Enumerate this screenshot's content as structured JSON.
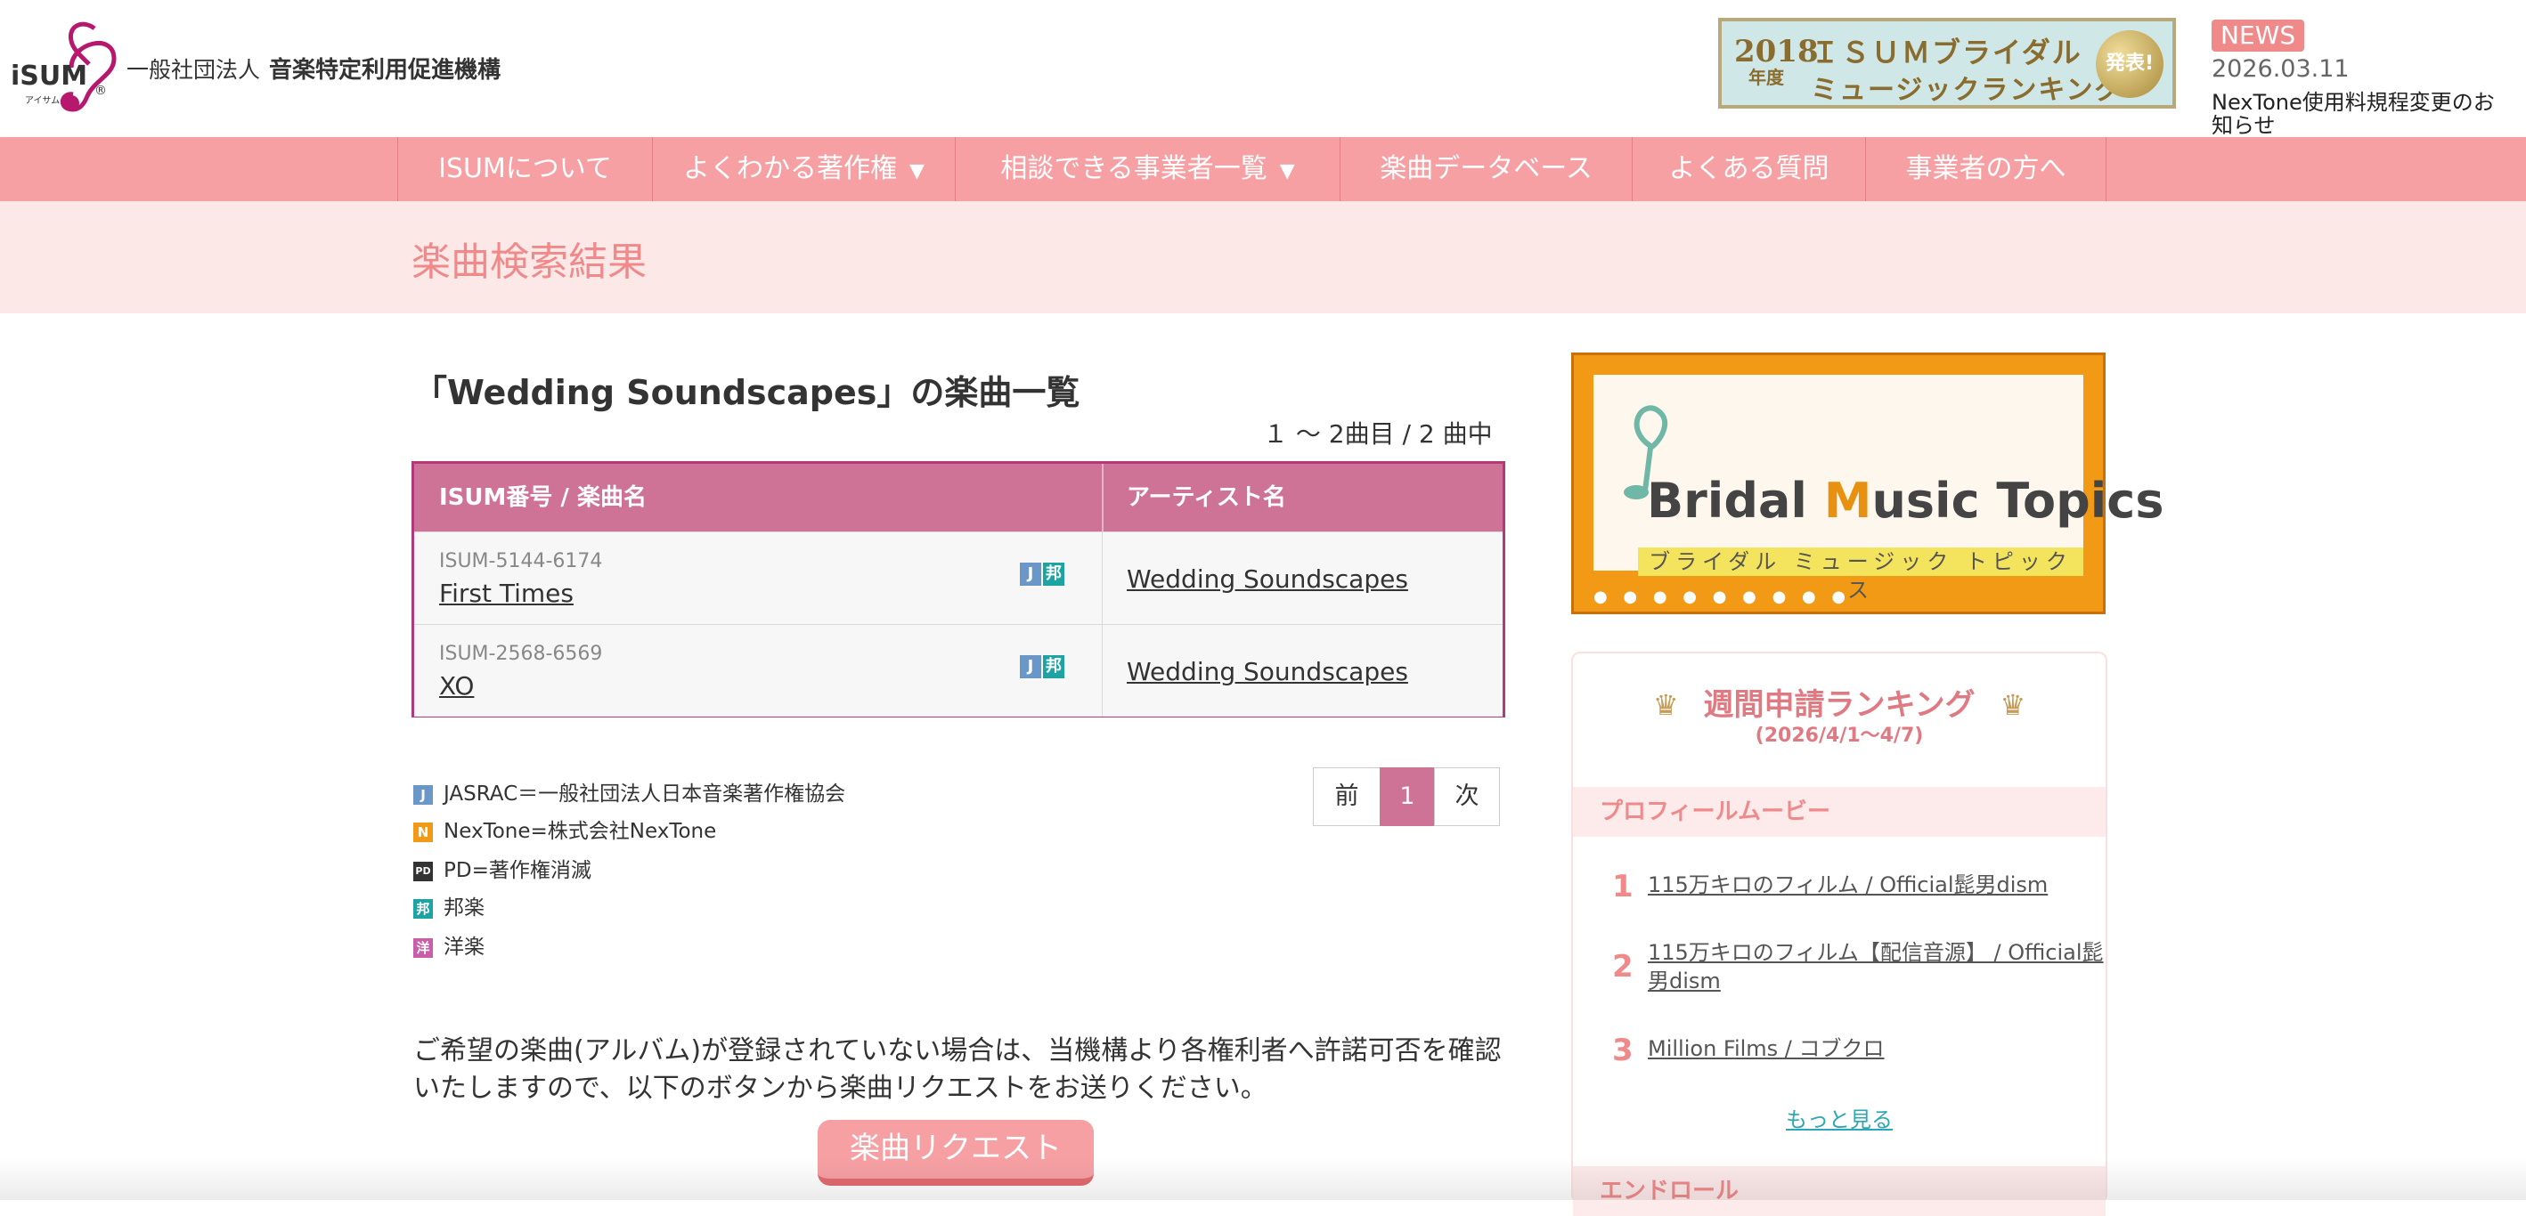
{
  "header": {
    "logo_text": "iSUM",
    "logo_sub": "アイサム",
    "org_prefix": "一般社団法人",
    "org_name": "音楽特定利用促進機構",
    "banner": {
      "year": "2018",
      "year_suffix": "年度",
      "line1": "ＩＳＵＭブライダル",
      "line2": "ミュージックランキング",
      "seal": "発表!"
    },
    "news": {
      "badge": "NEWS",
      "date": "2026.03.11",
      "text": "NexTone使用料規程変更のお知らせ"
    }
  },
  "nav": {
    "items": [
      {
        "label": "ISUMについて",
        "has_caret": false
      },
      {
        "label": "よくわかる著作権",
        "has_caret": true
      },
      {
        "label": "相談できる事業者一覧",
        "has_caret": true
      },
      {
        "label": "楽曲データベース",
        "has_caret": false
      },
      {
        "label": "よくある質問",
        "has_caret": false
      },
      {
        "label": "事業者の方へ",
        "has_caret": false
      }
    ],
    "caret": "▼"
  },
  "page": {
    "title": "楽曲検索結果",
    "list_heading": "「Wedding Soundscapes」の楽曲一覧",
    "result_count": "１ 〜 2曲目 / 2 曲中"
  },
  "table": {
    "headers": [
      "ISUM番号 / 楽曲名",
      "アーティスト名"
    ],
    "rows": [
      {
        "isum_no": "ISUM-5144-6174",
        "title": "First Times",
        "artist": "Wedding Soundscapes",
        "tags": [
          "J",
          "邦"
        ]
      },
      {
        "isum_no": "ISUM-2568-6569",
        "title": "XO",
        "artist": "Wedding Soundscapes",
        "tags": [
          "J",
          "邦"
        ]
      }
    ]
  },
  "legend": [
    {
      "icon": "J",
      "text": "JASRAC＝一般社団法人日本音楽著作権協会",
      "color": "#6a96c8"
    },
    {
      "icon": "N",
      "text": "NexTone=株式会社NexTone",
      "color": "#f29a16"
    },
    {
      "icon": "PD",
      "text": "PD=著作権消滅",
      "color": "#333333"
    },
    {
      "icon": "邦",
      "text": "邦楽",
      "color": "#1ea3a3"
    },
    {
      "icon": "洋",
      "text": "洋楽",
      "color": "#c95fa8"
    }
  ],
  "pager": {
    "prev": "前",
    "current": "1",
    "next": "次"
  },
  "request": {
    "text": "ご希望の楽曲(アルバム)が登録されていない場合は、当機構より各権利者へ許諾可否を確認いたしますので、以下のボタンから楽曲リクエストをお送りください。",
    "button": "楽曲リクエスト"
  },
  "sidebar": {
    "bmt": {
      "title_b": "B",
      "title_ridal": "ridal ",
      "title_m": "M",
      "title_usic": "usic ",
      "title_t": "T",
      "title_opics": "opics",
      "sub": "ブライダル ミュージック トピックス"
    },
    "ranking": {
      "title": "週間申請ランキング",
      "period": "(2026/4/1〜4/7)",
      "category": "プロフィールムービー",
      "items": [
        {
          "rank": "1",
          "label": "115万キロのフィルム / Official髭男dism"
        },
        {
          "rank": "2",
          "label": "115万キロのフィルム【配信音源】 / Official髭男dism"
        },
        {
          "rank": "3",
          "label": "Million Films / コブクロ"
        }
      ],
      "more": "もっと見る",
      "next_category": "エンドロール"
    }
  },
  "colors": {
    "nav": "#f7a0a4",
    "table_header": "#cf7396",
    "table_border": "#b23a78",
    "title_pink": "#f08a8a",
    "title_band": "#fde8e8"
  }
}
